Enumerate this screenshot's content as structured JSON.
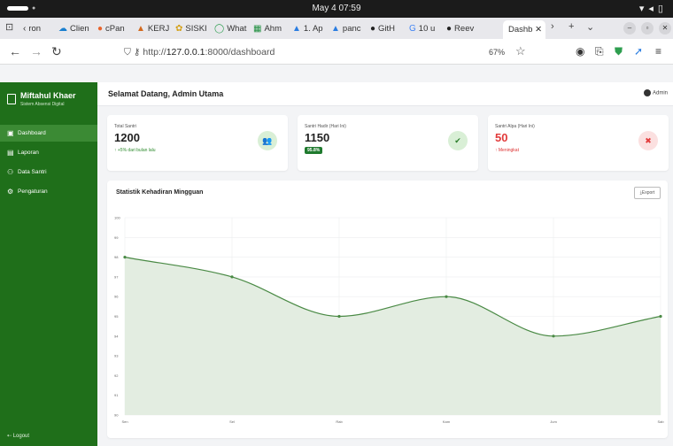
{
  "os": {
    "clock": "May 4  07:59"
  },
  "browser": {
    "tabs": [
      {
        "label": "ron",
        "icon": "back-arrow-icon"
      },
      {
        "label": "Clien",
        "icon": "cloud-icon"
      },
      {
        "label": "cPan",
        "icon": "cpanel-icon"
      },
      {
        "label": "KERJ",
        "icon": "cap-icon"
      },
      {
        "label": "SISKI",
        "icon": "flower-icon"
      },
      {
        "label": "What",
        "icon": "whatsapp-icon"
      },
      {
        "label": "Ahm",
        "icon": "sheet-icon"
      },
      {
        "label": "1. Ap",
        "icon": "drive-icon"
      },
      {
        "label": "panc",
        "icon": "drive-icon"
      },
      {
        "label": "GitH",
        "icon": "github-icon"
      },
      {
        "label": "10 u",
        "icon": "g-icon"
      },
      {
        "label": "Reev",
        "icon": "github-icon"
      }
    ],
    "active_tab": "Dashb",
    "url_scheme": "http://",
    "url_host": "127.0.0.1",
    "url_path": ":8000/dashboard",
    "zoom": "67%"
  },
  "sidebar": {
    "brand_name": "Miftahul Khaer",
    "brand_sub": "Sistem Absensi Digital",
    "items": [
      {
        "label": "Dashboard"
      },
      {
        "label": "Laporan"
      },
      {
        "label": "Data Santri"
      },
      {
        "label": "Pengaturan"
      }
    ],
    "logout": "Logout"
  },
  "header": {
    "welcome": "Selamat Datang, Admin Utama",
    "user": "Admin"
  },
  "cards": [
    {
      "label": "Total Santri",
      "value": "1200",
      "note": "↑ +5% dari bulan lalu"
    },
    {
      "label": "Santri Hadir (Hari Ini)",
      "value": "1150",
      "badge": "95.8%"
    },
    {
      "label": "Santri Alpa (Hari Ini)",
      "value": "50",
      "note": "↑ Meningkat"
    }
  ],
  "chart": {
    "title": "Statistik Kehadiran Mingguan",
    "export_label": "Export"
  },
  "chart_data": {
    "type": "area",
    "categories": [
      "Sen",
      "Sel",
      "Rab",
      "Kam",
      "Jum",
      "Sab"
    ],
    "values": [
      98,
      97,
      95,
      96,
      94,
      95
    ],
    "ylim": [
      90,
      100
    ],
    "yticks": [
      90,
      91,
      92,
      93,
      94,
      95,
      96,
      97,
      98,
      99,
      100
    ],
    "grid": true,
    "line_color": "#4a8a45",
    "fill_color": "#e3ede1"
  }
}
